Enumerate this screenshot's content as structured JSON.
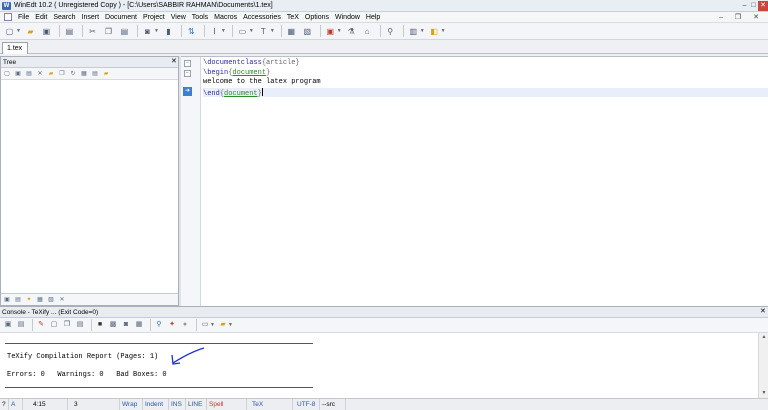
{
  "window": {
    "title": "WinEdt 10.2  ( Unregistered  Copy )  - [C:\\Users\\SABBIR RAHMAN\\Documents\\1.tex]",
    "app_icon": "W",
    "controls": {
      "minimize": "–",
      "maximize": "□",
      "close": "✕"
    }
  },
  "menubar": {
    "items": [
      "File",
      "Edit",
      "Search",
      "Insert",
      "Document",
      "Project",
      "View",
      "Tools",
      "Macros",
      "Accessories",
      "TeX",
      "Options",
      "Window",
      "Help"
    ],
    "right_controls": "– ❐ ✕"
  },
  "toolbar": {
    "icons": [
      "new-file-icon",
      "open-folder-icon",
      "save-icon",
      "print-icon",
      "cut-icon",
      "copy-icon",
      "paste-icon",
      "binoculars-icon",
      "bookmark-icon",
      "toggle-icon",
      "text-cursor-icon",
      "frame-icon",
      "font-icon",
      "table-icon",
      "image-icon",
      "build-icon",
      "chemistry-icon",
      "search-icon",
      "trash-icon",
      "latex-icon"
    ]
  },
  "tabs": {
    "active": "1.tex"
  },
  "tree": {
    "title": "Tree",
    "close": "✕"
  },
  "editor": {
    "lines": [
      {
        "cmd": "\\documentclass",
        "open": "{",
        "arg": "article",
        "close": "}"
      },
      {
        "cmd": "\\begin",
        "open": "{",
        "arg": "document",
        "close": "}"
      },
      {
        "text": "welcome to the latex program"
      },
      {
        "cmd": "\\end",
        "open": "{",
        "arg": "document",
        "close": "}"
      }
    ],
    "gutter_fold": "−"
  },
  "console": {
    "title": "Console - TeXify ... (Exit Code=0)",
    "close": "✕",
    "report_line": "TeXify Compilation Report (Pages: 1)",
    "errors_line": "Errors: 0   Warnings: 0   Bad Boxes: 0",
    "annotation_color": "#1f2fd6"
  },
  "statusbar": {
    "help": "?",
    "mode": "A",
    "position": "4:15",
    "lines": "3",
    "wrap": "Wrap",
    "indent": "Indent",
    "ins": "INS",
    "line": "LINE",
    "spell": "Spell",
    "tex": "TeX",
    "encoding": "UTF-8",
    "src": "--src"
  }
}
